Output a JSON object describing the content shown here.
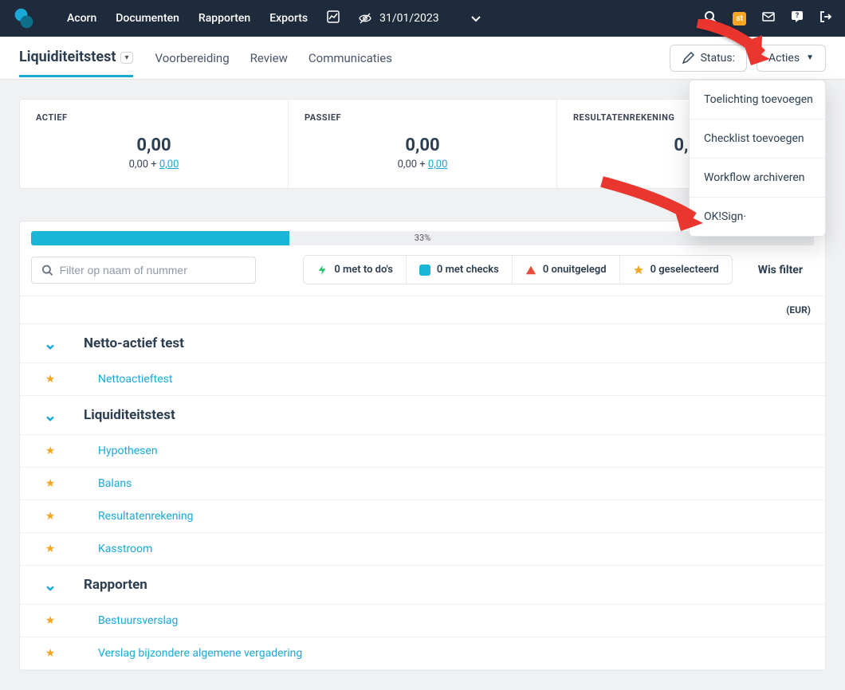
{
  "nav": {
    "brand": "S",
    "items": [
      "Acorn",
      "Documenten",
      "Rapporten",
      "Exports"
    ],
    "date": "31/01/2023",
    "badge": "st"
  },
  "subheader": {
    "title": "Liquiditeitstest",
    "tabs": [
      "Voorbereiding",
      "Review",
      "Communicaties"
    ],
    "status_label": "Status:",
    "actions_label": "Acties"
  },
  "dropdown": {
    "items": [
      "Toelichting toevoegen",
      "Checklist toevoegen",
      "Workflow archiveren",
      "OK!Sign·"
    ]
  },
  "summary": [
    {
      "label": "ACTIEF",
      "value": "0,00",
      "sub_prefix": "0,00 + ",
      "sub_link": "0,00"
    },
    {
      "label": "PASSIEF",
      "value": "0,00",
      "sub_prefix": "0,00 + ",
      "sub_link": "0,00"
    },
    {
      "label": "RESULTATENREKENING",
      "value": "0,00",
      "sub_prefix": "",
      "sub_link": ""
    }
  ],
  "progress": {
    "percent": 33,
    "label": "33%"
  },
  "filter": {
    "placeholder": "Filter op naam of nummer",
    "todos": "0 met to do's",
    "checks": "0 met checks",
    "unexplained": "0 onuitgelegd",
    "selected": "0 geselecteerd",
    "clear": "Wis filter"
  },
  "currency_label": "(EUR)",
  "sections": [
    {
      "type": "cat",
      "title": "Netto-actief test"
    },
    {
      "type": "item",
      "title": "Nettoactieftest"
    },
    {
      "type": "cat",
      "title": "Liquiditeitstest"
    },
    {
      "type": "item",
      "title": "Hypothesen"
    },
    {
      "type": "item",
      "title": "Balans"
    },
    {
      "type": "item",
      "title": "Resultatenrekening"
    },
    {
      "type": "item",
      "title": "Kasstroom"
    },
    {
      "type": "cat",
      "title": "Rapporten"
    },
    {
      "type": "item",
      "title": "Bestuursverslag"
    },
    {
      "type": "item",
      "title": "Verslag bijzondere algemene vergadering"
    }
  ],
  "colors": {
    "accent": "#1aa9d6",
    "star": "#f5a623",
    "bolt": "#23c26b",
    "tri": "#e64b3c"
  }
}
